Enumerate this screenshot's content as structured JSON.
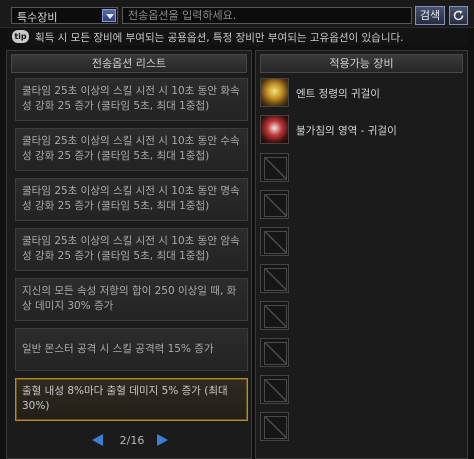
{
  "toolbar": {
    "category_selected": "특수장비",
    "search_placeholder": "전송옵션을 입력하세요.",
    "search_button": "검색",
    "refresh_icon": "refresh-icon"
  },
  "tip": {
    "badge": "tip",
    "text": "획득 시 모든 장비에 부여되는 공용옵션, 특정 장비만 부여되는 고유옵션이 있습니다."
  },
  "options_panel": {
    "title": "전송옵션 리스트",
    "options": [
      {
        "text": "쿨타임 25초 이상의 스킬 시전 시 10초 동안 화속성 강화 25 증가 (쿨타임 5초, 최대 1중첩)"
      },
      {
        "text": "쿨타임 25초 이상의 스킬 시전 시 10초 동안 수속성 강화 25 증가 (쿨타임 5초, 최대 1중첩)"
      },
      {
        "text": "쿨타임 25초 이상의 스킬 시전 시 10초 동안 명속성 강화 25 증가 (쿨타임 5초, 최대 1중첩)"
      },
      {
        "text": "쿨타임 25초 이상의 스킬 시전 시 10초 동안 암속성 강화 25 증가 (쿨타임 5초, 최대 1중첩)"
      },
      {
        "text": "지신의 모든 속성 저항의 합이 250 이상일 때, 화상 데미지 30% 증가"
      },
      {
        "text": "일반 몬스터 공격 시 스킬 공격력 15% 증가"
      },
      {
        "text": "출혈 내성 8%마다 출혈 데미지 5% 증가 (최대 30%)",
        "selected": true
      }
    ],
    "pager": {
      "text": "2/16"
    }
  },
  "equip_panel": {
    "title": "적용가능 장비",
    "items": [
      {
        "name": "엔트 정령의 귀걸이",
        "icon": "earring-gold-icon"
      },
      {
        "name": "불가침의 영역 - 귀걸이",
        "icon": "earring-red-icon"
      },
      {
        "name": "",
        "icon": "empty-slot-icon"
      },
      {
        "name": "",
        "icon": "empty-slot-icon"
      },
      {
        "name": "",
        "icon": "empty-slot-icon"
      },
      {
        "name": "",
        "icon": "empty-slot-icon"
      },
      {
        "name": "",
        "icon": "empty-slot-icon"
      },
      {
        "name": "",
        "icon": "empty-slot-icon"
      },
      {
        "name": "",
        "icon": "empty-slot-icon"
      },
      {
        "name": "",
        "icon": "empty-slot-icon"
      },
      {
        "name": "",
        "icon": "empty-slot-icon"
      }
    ]
  },
  "colors": {
    "accent": "#3b7fd3",
    "selected_border": "#b58a2c"
  }
}
